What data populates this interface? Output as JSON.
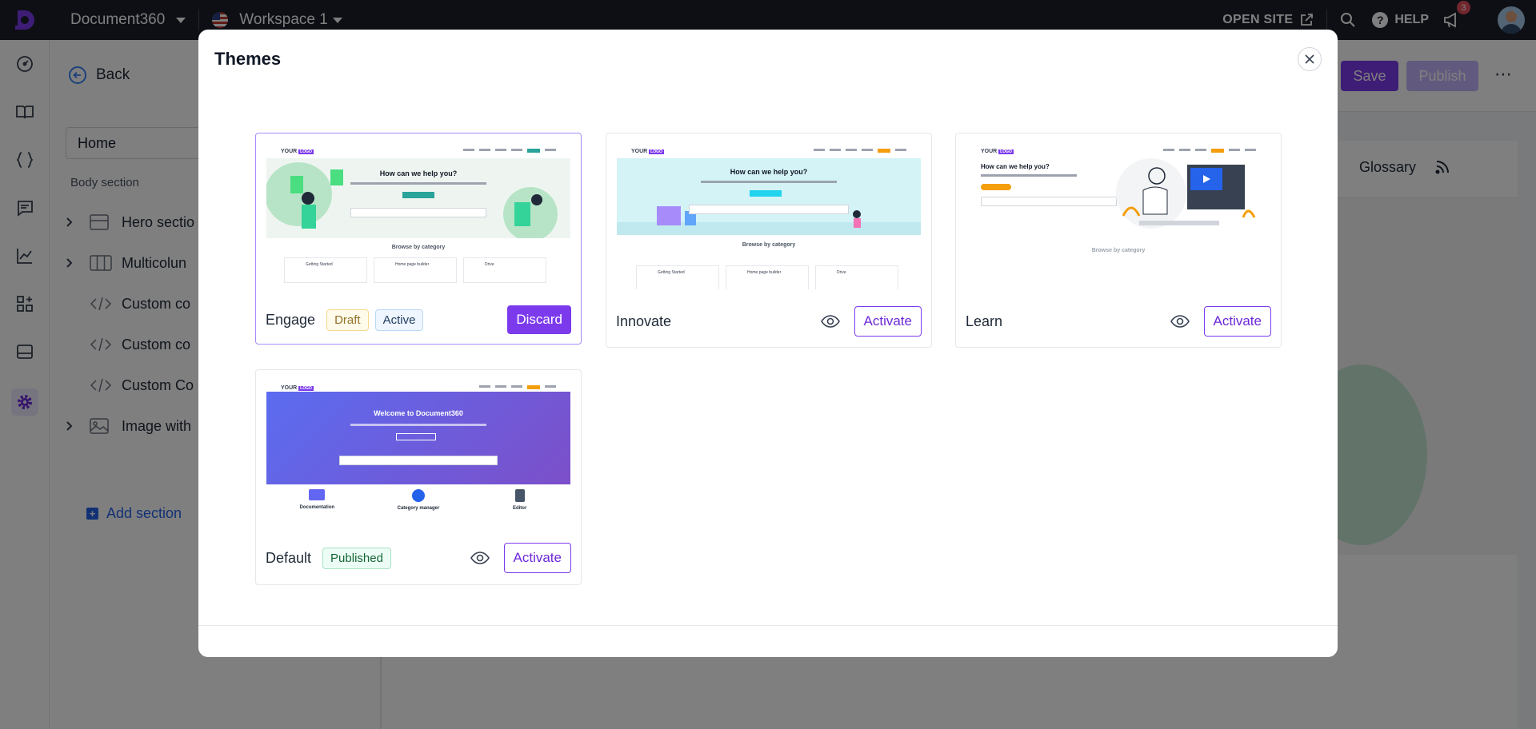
{
  "topbar": {
    "project_name": "Document360",
    "workspace": "Workspace 1",
    "open_site": "OPEN SITE",
    "help": "HELP",
    "notification_count": "3"
  },
  "panel": {
    "back_label": "Back",
    "page_select": "Home",
    "body_section_label": "Body section",
    "items": [
      {
        "label": "Hero sectio"
      },
      {
        "label": "Multicolun"
      },
      {
        "label": "Custom co"
      },
      {
        "label": "Custom co"
      },
      {
        "label": "Custom Co"
      },
      {
        "label": "Image with"
      }
    ],
    "add_section": "Add section"
  },
  "editor": {
    "save": "Save",
    "publish": "Publish",
    "glossary": "Glossary"
  },
  "modal": {
    "title": "Themes",
    "themes": [
      {
        "name": "Engage",
        "tags": [
          "Draft",
          "Active"
        ],
        "action": "Discard",
        "preview": {
          "heading": "How can we help you?",
          "browse": "Browse by category",
          "cards": [
            "Getting Started",
            "Home page builder",
            "Drive"
          ]
        }
      },
      {
        "name": "Innovate",
        "action": "Activate",
        "preview": {
          "heading": "How can we help you?",
          "browse": "Browse by category",
          "cards": [
            "Getting Started",
            "Home page builder",
            "Drive"
          ]
        }
      },
      {
        "name": "Learn",
        "action": "Activate",
        "preview": {
          "heading": "How can we help you?",
          "browse": "Browse by category"
        }
      },
      {
        "name": "Default",
        "tags": [
          "Published"
        ],
        "action": "Activate",
        "preview": {
          "heading": "Welcome to Document360",
          "features": [
            "Documentation",
            "Category manager",
            "Editor"
          ]
        }
      }
    ]
  },
  "colors": {
    "accent": "#7c3aed",
    "topbar": "#1d1f2b",
    "link": "#2563eb"
  }
}
